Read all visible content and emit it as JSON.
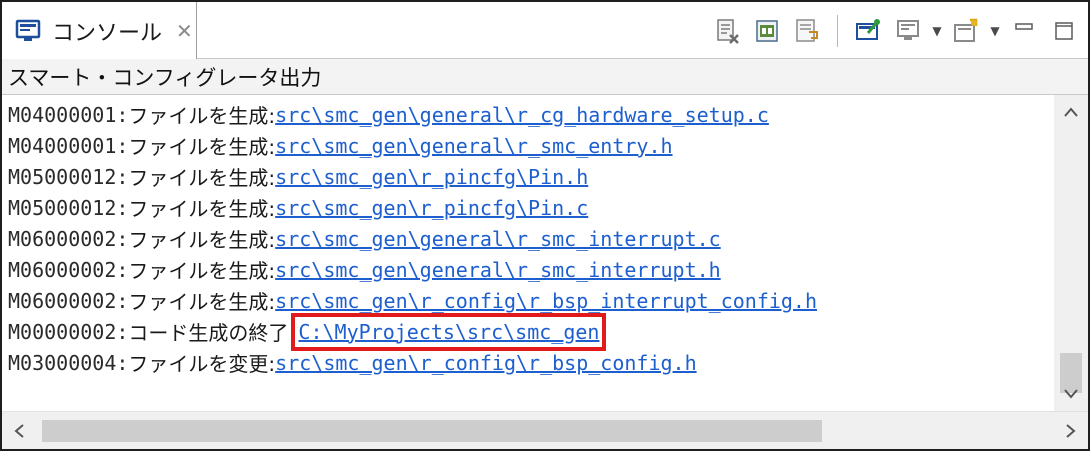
{
  "tab": {
    "title": "コンソール",
    "close_glyph": "✕",
    "icon": "console-icon"
  },
  "toolbar": {
    "buttons": [
      {
        "name": "clear-console-icon"
      },
      {
        "name": "scroll-lock-icon"
      },
      {
        "name": "word-wrap-icon"
      },
      {
        "name": "pin-console-icon"
      },
      {
        "name": "display-selected-console-icon"
      },
      {
        "name": "open-console-icon"
      },
      {
        "name": "minimize-icon"
      },
      {
        "name": "maximize-icon"
      }
    ]
  },
  "panel": {
    "header": "スマート・コンフィグレータ出力"
  },
  "log": {
    "lines": [
      {
        "code": "M04000001:",
        "msg": " ファイルを生成:",
        "link": "src\\smc_gen\\general\\r_cg_hardware_setup.c"
      },
      {
        "code": "M04000001:",
        "msg": " ファイルを生成:",
        "link": "src\\smc_gen\\general\\r_smc_entry.h"
      },
      {
        "code": "M05000012:",
        "msg": " ファイルを生成:",
        "link": "src\\smc_gen\\r_pincfg\\Pin.h"
      },
      {
        "code": "M05000012:",
        "msg": " ファイルを生成:",
        "link": "src\\smc_gen\\r_pincfg\\Pin.c"
      },
      {
        "code": "M06000002:",
        "msg": " ファイルを生成:",
        "link": "src\\smc_gen\\general\\r_smc_interrupt.c"
      },
      {
        "code": "M06000002:",
        "msg": " ファイルを生成:",
        "link": "src\\smc_gen\\general\\r_smc_interrupt.h"
      },
      {
        "code": "M06000002:",
        "msg": " ファイルを生成:",
        "link": "src\\smc_gen\\r_config\\r_bsp_interrupt_config.h"
      },
      {
        "code": "M00000002:",
        "msg": " コード生成の終了",
        "link": "C:\\MyProjects\\src\\smc_gen"
      },
      {
        "code": "M03000004:",
        "msg": " ファイルを変更:",
        "link": "src\\smc_gen\\r_config\\r_bsp_config.h"
      }
    ]
  },
  "scrollbars": {
    "up": "^",
    "down": "v",
    "left": "<",
    "right": ">"
  },
  "colors": {
    "link": "#1e5fcf",
    "highlight_box": "#e11b1b"
  }
}
